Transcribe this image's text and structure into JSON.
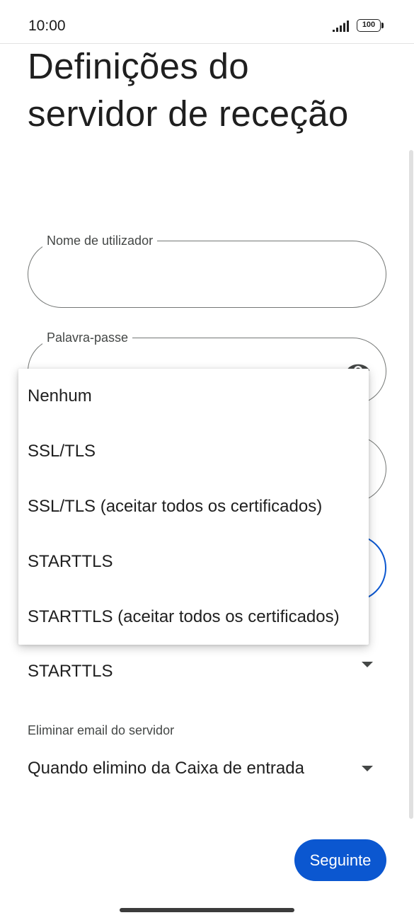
{
  "status_bar": {
    "time": "10:00",
    "battery": "100"
  },
  "page": {
    "title": "Definições do servidor de receção"
  },
  "fields": {
    "username_label": "Nome de utilizador",
    "password_label": "Palavra-passe"
  },
  "security": {
    "value": "STARTTLS"
  },
  "delete_email": {
    "label": "Eliminar email do servidor",
    "value": "Quando elimino da Caixa de entrada"
  },
  "next_button": "Seguinte",
  "security_menu": {
    "items": [
      "Nenhum",
      "SSL/TLS",
      "SSL/TLS (aceitar todos os certificados)",
      "STARTTLS",
      "STARTTLS (aceitar todos os certificados)"
    ]
  },
  "colors": {
    "accent": "#0b57d0",
    "outline": "#747775"
  }
}
